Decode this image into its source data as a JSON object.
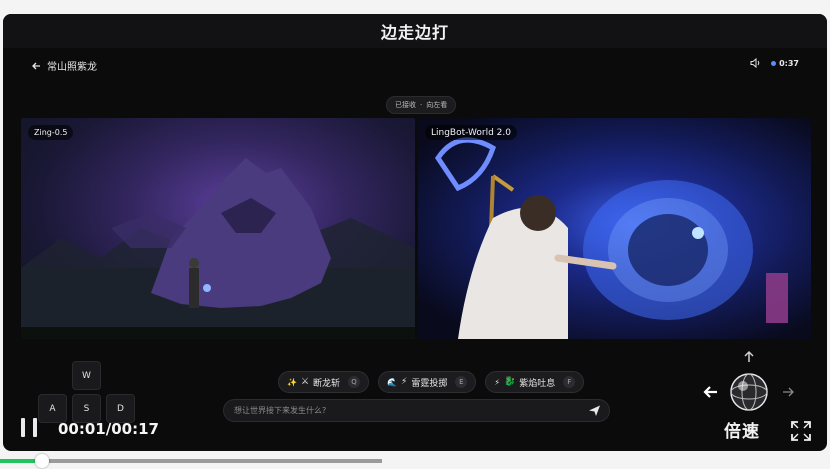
{
  "app": {
    "title": "边走边打"
  },
  "header": {
    "back_label": "常山照紫龙",
    "timer": "0:37"
  },
  "status_chip": {
    "left": "已接收",
    "separator": "·",
    "right": "向左看"
  },
  "panels": {
    "left_label": "Zing-0.5",
    "right_label": "LingBot-World 2.0"
  },
  "actions": [
    {
      "emoji": "✨",
      "icon": "⚔",
      "label": "断龙斩",
      "key": "Q"
    },
    {
      "emoji": "🌊",
      "icon": "⚡",
      "label": "雷霆投掷",
      "key": "E"
    },
    {
      "emoji": "⚡",
      "icon": "🐉",
      "label": "紫焰吐息",
      "key": "F"
    }
  ],
  "prompt": {
    "placeholder": "想让世界接下来发生什么?"
  },
  "keys": {
    "w": "W",
    "a": "A",
    "s": "S",
    "d": "D"
  },
  "playback": {
    "time": "00:01/00:17",
    "speed_label": "倍速",
    "progress": 0.11
  },
  "colors": {
    "progress": "#22c35e",
    "status_dot": "#5b8cff",
    "background": "#0b0b0c"
  },
  "icons": [
    "back-arrow-icon",
    "speaker-icon",
    "send-icon",
    "pause-icon",
    "fullscreen-icon",
    "joystick-icon"
  ]
}
